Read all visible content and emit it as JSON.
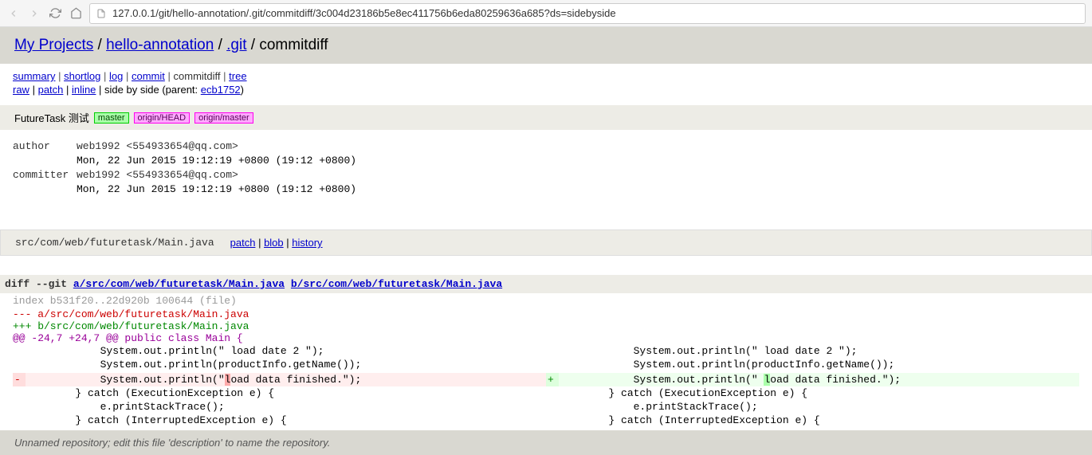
{
  "url": "127.0.0.1/git/hello-annotation/.git/commitdiff/3c004d23186b5e8ec411756b6eda80259636a685?ds=sidebyside",
  "breadcrumb": {
    "projects": "My Projects",
    "repo": "hello-annotation",
    "git": ".git",
    "page": "commitdiff"
  },
  "nav1": {
    "summary": "summary",
    "shortlog": "shortlog",
    "log": "log",
    "commit": "commit",
    "commitdiff": "commitdiff",
    "tree": "tree"
  },
  "nav2": {
    "raw": "raw",
    "patch": "patch",
    "inline": "inline",
    "sidebyside": "side by side",
    "parent_label": "parent:",
    "parent_hash": "ecb1752"
  },
  "commit": {
    "title": "FutureTask 测试",
    "badges": [
      "master",
      "origin/HEAD",
      "origin/master"
    ]
  },
  "meta": {
    "author_label": "author",
    "author_val": "web1992 <554933654@qq.com>",
    "author_date": "Mon, 22 Jun 2015 19:12:19 +0800 (19:12 +0800)",
    "committer_label": "committer",
    "committer_val": "web1992 <554933654@qq.com>",
    "committer_date": "Mon, 22 Jun 2015 19:12:19 +0800 (19:12 +0800)"
  },
  "file": {
    "name": "src/com/web/futuretask/Main.java",
    "actions": {
      "patch": "patch",
      "blob": "blob",
      "history": "history"
    }
  },
  "diff": {
    "header_prefix": "diff --git ",
    "header_a": "a/src/com/web/futuretask/Main.java",
    "header_b": "b/src/com/web/futuretask/Main.java",
    "index": "index b531f20..22d920b 100644 (file)",
    "old_path": "--- a/src/com/web/futuretask/Main.java",
    "new_path": "+++ b/src/com/web/futuretask/Main.java",
    "hunk": "@@ -24,7 +24,7 @@",
    "hunk_ctx": " public class Main {",
    "ctx1": "            System.out.println(\" load date 2 \");",
    "ctx2": "            System.out.println(productInfo.getName());",
    "del_pre": "            System.out.println(\"",
    "del_hl": "l",
    "del_post": "oad data finished.\");",
    "add_pre": "            System.out.println(\" ",
    "add_hl": "l",
    "add_post": "oad data finished.\");",
    "ctx3": "        } catch (ExecutionException e) {",
    "ctx4": "            e.printStackTrace();",
    "ctx5": "        } catch (InterruptedException e) {"
  },
  "footer": "Unnamed repository; edit this file 'description' to name the repository."
}
